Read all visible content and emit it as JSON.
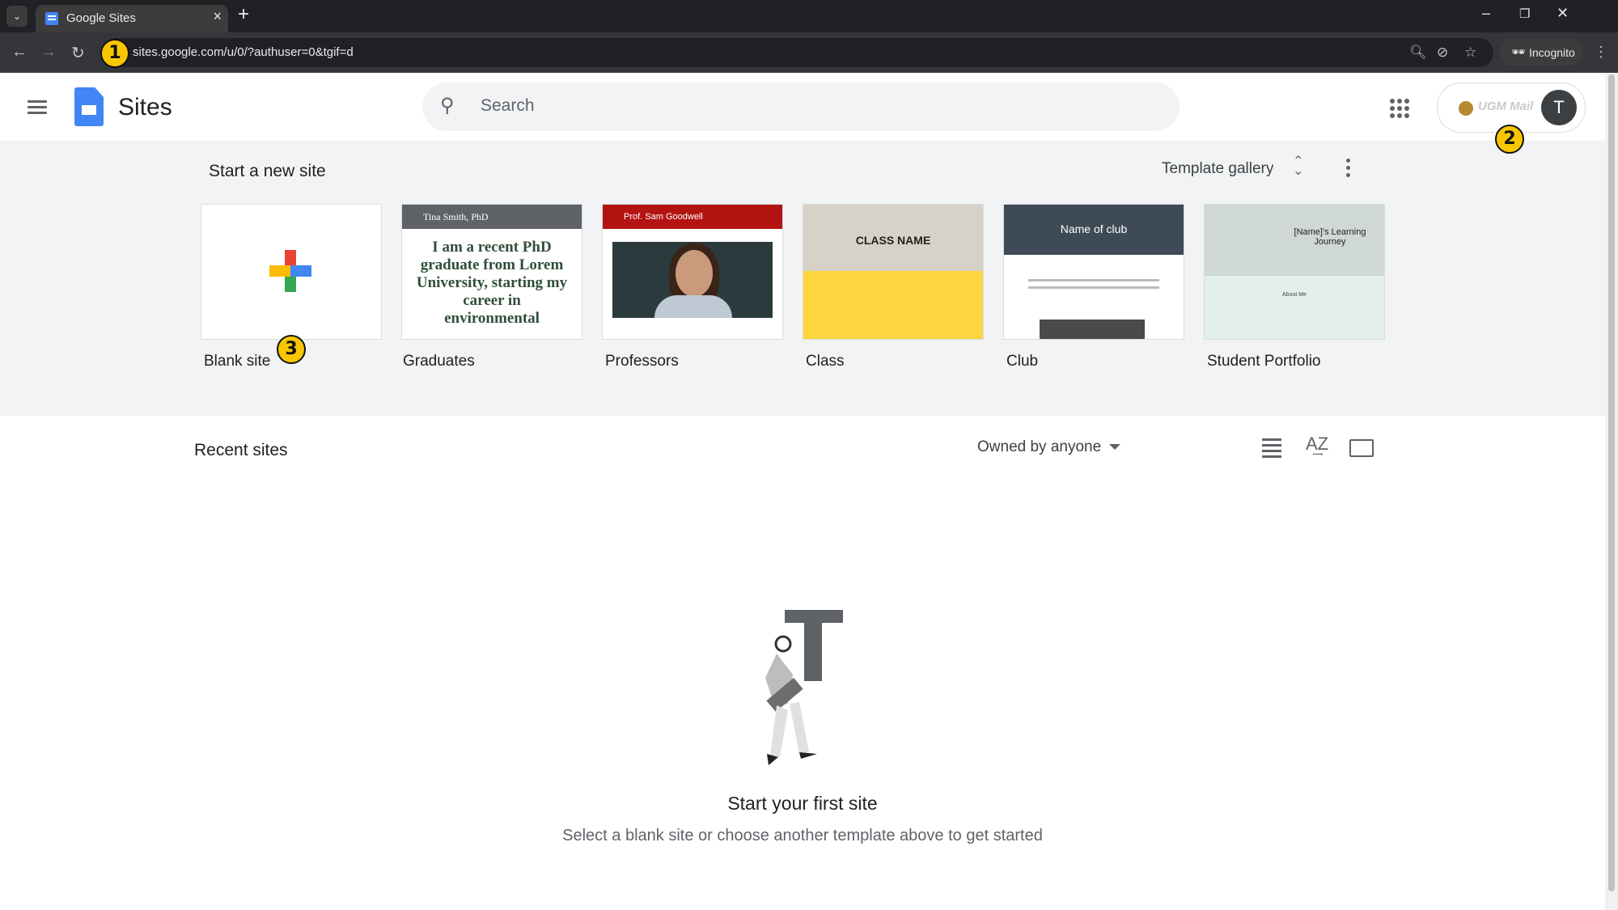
{
  "browser": {
    "tab_title": "Google Sites",
    "url": "sites.google.com/u/0/?authuser=0&tgif=d",
    "incognito_label": "Incognito"
  },
  "header": {
    "app_name": "Sites",
    "search_placeholder": "Search",
    "avatar_initial": "T",
    "org_label": "UGM Mail"
  },
  "gallery": {
    "title": "Start a new site",
    "template_gallery_label": "Template gallery",
    "templates": [
      {
        "label": "Blank site"
      },
      {
        "label": "Graduates",
        "preview_header": "Tina Smith, PhD",
        "preview_text": "I am a recent PhD graduate from Lorem University, starting my career in environmental"
      },
      {
        "label": "Professors",
        "preview_header": "Prof. Sam Goodwell"
      },
      {
        "label": "Class",
        "preview_title": "CLASS NAME"
      },
      {
        "label": "Club",
        "preview_title": "Name of club"
      },
      {
        "label": "Student Portfolio",
        "preview_title": "[Name]'s Learning Journey",
        "preview_sub": "About Me"
      }
    ]
  },
  "recent": {
    "title": "Recent sites",
    "owner_filter": "Owned by anyone"
  },
  "empty_state": {
    "title": "Start your first site",
    "subtitle": "Select a blank site or choose another template above to get started"
  },
  "markers": [
    "1",
    "2",
    "3"
  ],
  "colors": {
    "accent_blue": "#4285f4",
    "marker_yellow": "#f7c600",
    "plus_red": "#ea4335",
    "plus_blue": "#4285f4",
    "plus_green": "#34a853",
    "plus_yellow": "#fbbc04"
  }
}
